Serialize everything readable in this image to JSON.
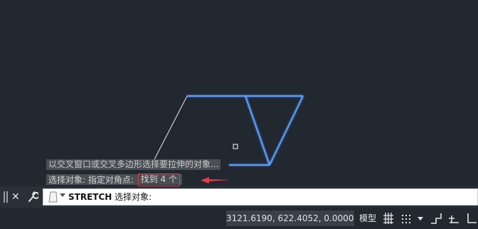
{
  "history": {
    "line1": "以交叉窗口或交叉多边形选择要拉伸的对象...",
    "line2_prefix": "选择对象: 指定对角点:",
    "line2_found": "找到 4 个"
  },
  "command": {
    "name": "STRETCH",
    "prompt": "选择对象:"
  },
  "status": {
    "coordinates": "3121.6190, 622.4052, 0.0000",
    "model_label": "模型"
  },
  "colors": {
    "background": "#212830",
    "selected_line": "#4a8fff",
    "highlight_box": "#e8394d"
  },
  "icons": [
    "close-icon",
    "wrench-icon",
    "stretch-command-icon",
    "grid-icon",
    "snap-icon",
    "chevron-down-icon",
    "ortho-icon",
    "polar-icon",
    "object-snap-icon"
  ]
}
